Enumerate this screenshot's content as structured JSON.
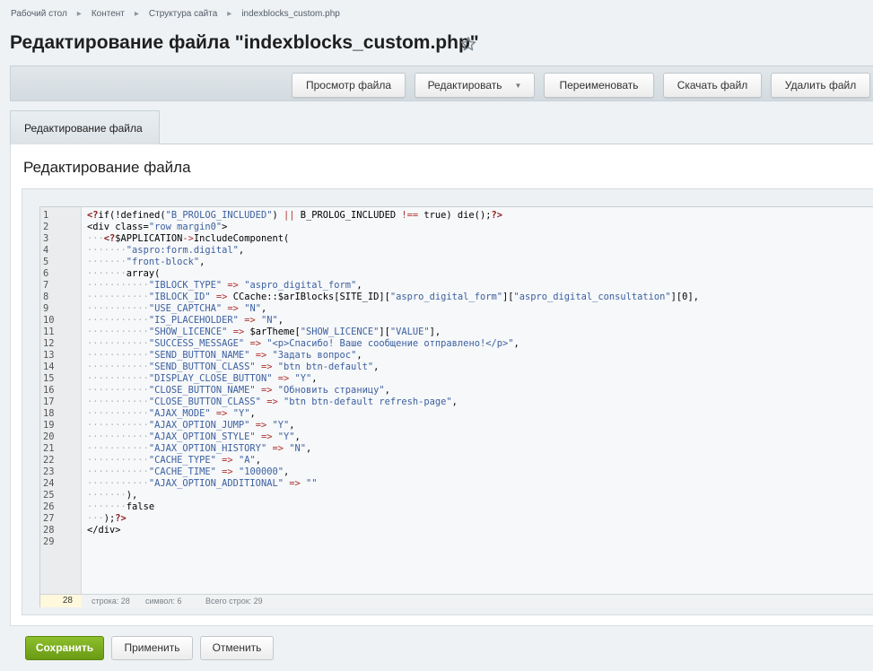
{
  "breadcrumb": {
    "items": [
      "Рабочий стол",
      "Контент",
      "Структура сайта",
      "indexblocks_custom.php"
    ]
  },
  "page": {
    "title": "Редактирование файла \"indexblocks_custom.php\""
  },
  "toolbar": {
    "view_label": "Просмотр файла",
    "edit_label": "Редактировать",
    "rename_label": "Переименовать",
    "download_label": "Скачать файл",
    "delete_label": "Удалить файл"
  },
  "tabs": [
    {
      "label": "Редактирование файла",
      "active": true
    }
  ],
  "section": {
    "title": "Редактирование файла"
  },
  "editor": {
    "lines": [
      "<?if(!defined(\"B_PROLOG_INCLUDED\") || B_PROLOG_INCLUDED !== true) die();?>",
      "<div class=\"row margin0\">",
      "···<?$APPLICATION->IncludeComponent(",
      "·······\"aspro:form.digital\",",
      "·······\"front-block\",",
      "·······array(",
      "···········\"IBLOCK_TYPE\" => \"aspro_digital_form\",",
      "···········\"IBLOCK_ID\" => CCache::$arIBlocks[SITE_ID][\"aspro_digital_form\"][\"aspro_digital_consultation\"][0],",
      "···········\"USE_CAPTCHA\" => \"N\",",
      "···········\"IS_PLACEHOLDER\" => \"N\",",
      "···········\"SHOW_LICENCE\" => $arTheme[\"SHOW_LICENCE\"][\"VALUE\"],",
      "···········\"SUCCESS_MESSAGE\" => \"<p>Спасибо! Ваше сообщение отправлено!</p>\",",
      "···········\"SEND_BUTTON_NAME\" => \"Задать вопрос\",",
      "···········\"SEND_BUTTON_CLASS\" => \"btn btn-default\",",
      "···········\"DISPLAY_CLOSE_BUTTON\" => \"Y\",",
      "···········\"CLOSE_BUTTON_NAME\" => \"Обновить страницу\",",
      "···········\"CLOSE_BUTTON_CLASS\" => \"btn btn-default refresh-page\",",
      "···········\"AJAX_MODE\" => \"Y\",",
      "···········\"AJAX_OPTION_JUMP\" => \"Y\",",
      "···········\"AJAX_OPTION_STYLE\" => \"Y\",",
      "···········\"AJAX_OPTION_HISTORY\" => \"N\",",
      "···········\"CACHE_TYPE\" => \"A\",",
      "···········\"CACHE_TIME\" => \"100000\",",
      "···········\"AJAX_OPTION_ADDITIONAL\" => \"\"",
      "·······),",
      "·······false",
      "···);?>",
      "</div>",
      ""
    ],
    "status": {
      "current_line": "28",
      "line_text": "строка: 28",
      "symbol_text": "символ: 6",
      "total_text": "Всего строк: 29"
    }
  },
  "footer": {
    "save_label": "Сохранить",
    "apply_label": "Применить",
    "cancel_label": "Отменить"
  },
  "colors": {
    "save_button": "#7aab1f",
    "toolbar_bg": "#d9e0e4",
    "page_bg": "#eef2f4"
  },
  "icons": {
    "favorite": "star-icon",
    "breadcrumb_separator": "chevron-right-icon",
    "dropdown": "chevron-down-icon"
  }
}
